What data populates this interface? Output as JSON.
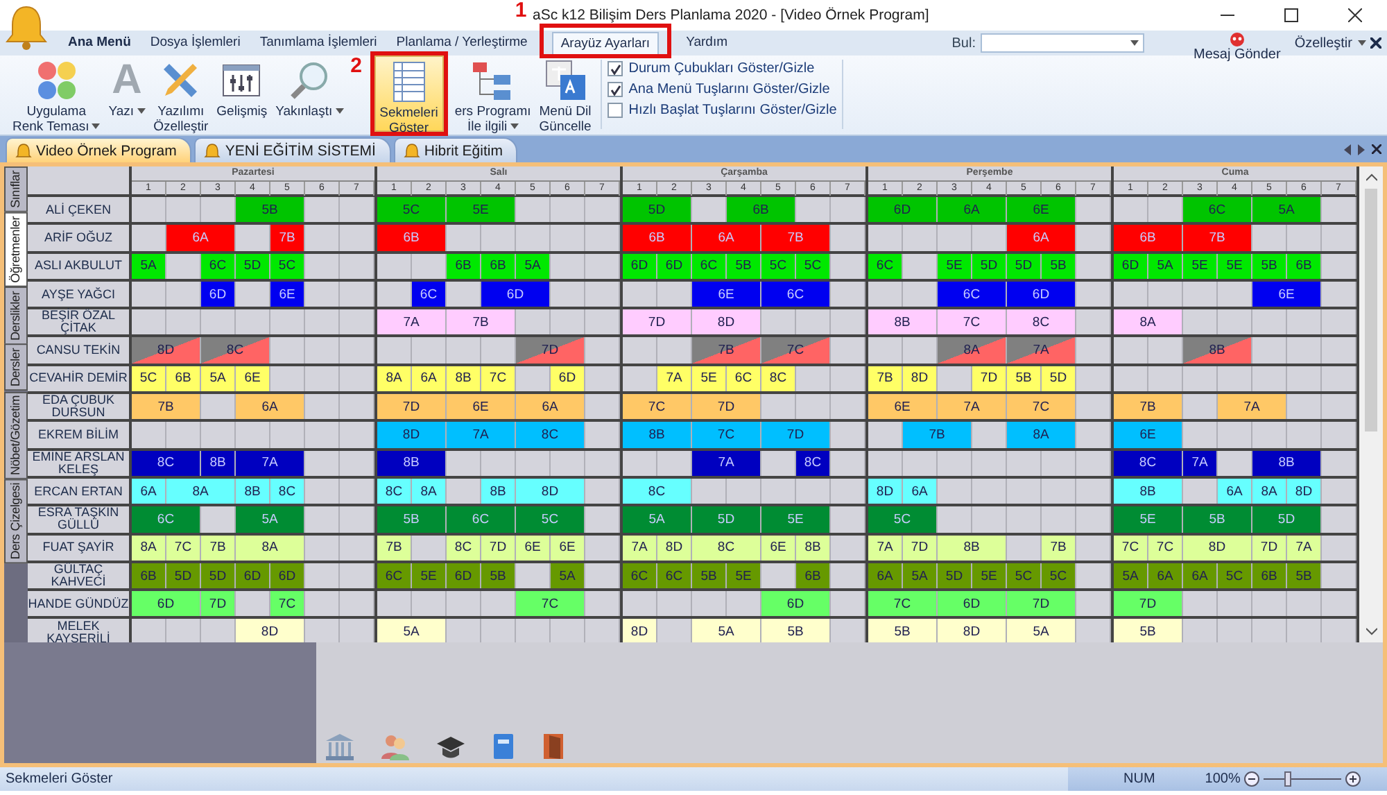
{
  "window": {
    "title": "aSc k12 Bilişim Ders Planlama 2020  - [Video Örnek Program]"
  },
  "menu_tabs": [
    {
      "label": "Ana Menü",
      "selected": false,
      "kind": "main"
    },
    {
      "label": "Dosya İşlemleri",
      "selected": false,
      "kind": "plain"
    },
    {
      "label": "Tanımlama İşlemleri",
      "selected": false,
      "kind": "plain"
    },
    {
      "label": "Planlama / Yerleştirme",
      "selected": false,
      "kind": "plain"
    },
    {
      "label": "Arayüz Ayarları",
      "selected": true,
      "kind": "plain",
      "annotation": "1"
    },
    {
      "label": "Yardım",
      "selected": false,
      "kind": "plain"
    }
  ],
  "find": {
    "label": "Bul:"
  },
  "message_button": {
    "label": "Mesaj Gönder"
  },
  "customize": {
    "label": "Özelleştir"
  },
  "ribbon": {
    "buttons": [
      {
        "label": "Uygulama\nRenk Teması",
        "kind": "palette",
        "dropdown": true,
        "selected": false
      },
      {
        "label": "Yazı",
        "kind": "font",
        "glyph": "A",
        "dropdown": true,
        "selected": false
      },
      {
        "label": "Yazılımı\nÖzelleştir",
        "kind": "tools",
        "dropdown": false,
        "selected": false
      },
      {
        "label": "Gelişmiş",
        "kind": "sliders",
        "dropdown": false,
        "selected": false
      },
      {
        "label": "Yakınlaştı",
        "kind": "magnifier",
        "dropdown": true,
        "selected": false
      },
      {
        "label": "Sekmeleri\nGöster",
        "kind": "sheet",
        "dropdown": false,
        "selected": true,
        "annotation": "2"
      },
      {
        "label": "ers Programı\nİle ilgili",
        "kind": "flow",
        "dropdown": true,
        "selected": false
      },
      {
        "label": "Menü Dil\nGüncelle",
        "kind": "language",
        "dropdown": false,
        "selected": false
      }
    ],
    "checkboxes": [
      {
        "label": "Durum Çubukları Göster/Gizle",
        "checked": true
      },
      {
        "label": "Ana Menü Tuşlarını Göster/Gizle",
        "checked": true
      },
      {
        "label": "Hızlı Başlat Tuşlarını Göster/Gizle",
        "checked": false
      }
    ]
  },
  "document_tabs": [
    {
      "label": "Video Örnek Program",
      "selected": true
    },
    {
      "label": "YENİ EĞİTİM SİSTEMİ",
      "selected": false
    },
    {
      "label": "Hibrit Eğitim",
      "selected": false
    }
  ],
  "side_tabs": [
    {
      "label": "Sınıflar",
      "selected": false
    },
    {
      "label": "Öğretmenler",
      "selected": true
    },
    {
      "label": "Derslikler",
      "selected": false
    },
    {
      "label": "Dersler",
      "selected": false
    },
    {
      "label": "Nöbet/Gözetim",
      "selected": false
    },
    {
      "label": "Ders Çizelgesi",
      "selected": false
    }
  ],
  "days": [
    {
      "name": "Pazartesi",
      "periods": [
        "1",
        "2",
        "3",
        "4",
        "5",
        "6",
        "7"
      ]
    },
    {
      "name": "Salı",
      "periods": [
        "1",
        "2",
        "3",
        "4",
        "5",
        "6",
        "7"
      ]
    },
    {
      "name": "Çarşamba",
      "periods": [
        "1",
        "2",
        "3",
        "4",
        "5",
        "6",
        "7"
      ]
    },
    {
      "name": "Perşembe",
      "periods": [
        "1",
        "2",
        "3",
        "4",
        "5",
        "6",
        "7"
      ]
    },
    {
      "name": "Cuma",
      "periods": [
        "1",
        "2",
        "3",
        "4",
        "5",
        "6",
        "7"
      ]
    }
  ],
  "teachers": [
    {
      "name": "ALİ ÇEKEN",
      "color": "#00c400",
      "kind": "solid",
      "days": [
        [
          {
            "kind": "empty"
          },
          {
            "kind": "empty"
          },
          {
            "kind": "empty"
          },
          {
            "kind": "double",
            "label": "5B"
          },
          {
            "kind": "empty"
          },
          {
            "kind": "empty"
          }
        ],
        [
          {
            "kind": "double",
            "label": "5C"
          },
          {
            "kind": "double",
            "label": "5E"
          },
          {
            "kind": "empty"
          },
          {
            "kind": "empty"
          },
          {
            "kind": "empty"
          }
        ],
        [
          {
            "kind": "double",
            "label": "5D"
          },
          {
            "kind": "empty"
          },
          {
            "kind": "double",
            "label": "6B"
          },
          {
            "kind": "empty"
          },
          {
            "kind": "empty"
          }
        ],
        [
          {
            "kind": "double",
            "label": "6D"
          },
          {
            "kind": "double",
            "label": "6A"
          },
          {
            "kind": "double",
            "label": "6E"
          },
          {
            "kind": "empty"
          }
        ],
        [
          {
            "kind": "empty"
          },
          {
            "kind": "empty"
          },
          {
            "kind": "double",
            "label": "6C"
          },
          {
            "kind": "double",
            "label": "5A"
          },
          {
            "kind": "empty"
          }
        ]
      ]
    },
    {
      "name": "ARİF OĞUZ",
      "color": "#ff0000",
      "kind": "solid",
      "days": [
        [
          {
            "kind": "empty"
          },
          {
            "kind": "double",
            "label": "6A"
          },
          {
            "kind": "empty"
          },
          {
            "kind": "single",
            "label": "7B"
          },
          {
            "kind": "empty"
          },
          {
            "kind": "empty"
          }
        ],
        [
          {
            "kind": "double",
            "label": "6B"
          },
          {
            "kind": "empty"
          },
          {
            "kind": "empty"
          },
          {
            "kind": "empty"
          },
          {
            "kind": "empty"
          },
          {
            "kind": "empty"
          }
        ],
        [
          {
            "kind": "double",
            "label": "6B"
          },
          {
            "kind": "double",
            "label": "6A"
          },
          {
            "kind": "double",
            "label": "7B"
          },
          {
            "kind": "empty"
          }
        ],
        [
          {
            "kind": "empty"
          },
          {
            "kind": "empty"
          },
          {
            "kind": "empty"
          },
          {
            "kind": "empty"
          },
          {
            "kind": "double",
            "label": "6A"
          },
          {
            "kind": "empty"
          }
        ],
        [
          {
            "kind": "double",
            "label": "6B"
          },
          {
            "kind": "double",
            "label": "7B"
          },
          {
            "kind": "empty"
          },
          {
            "kind": "empty"
          },
          {
            "kind": "empty"
          }
        ]
      ]
    },
    {
      "name": "ASLI AKBULUT",
      "color": "#00e800",
      "kind": "solid",
      "days": [
        [
          {
            "kind": "single",
            "label": "5A"
          },
          {
            "kind": "empty"
          },
          {
            "kind": "single",
            "label": "6C"
          },
          {
            "kind": "single",
            "label": "5D"
          },
          {
            "kind": "single",
            "label": "5C"
          },
          {
            "kind": "empty"
          },
          {
            "kind": "empty"
          }
        ],
        [
          {
            "kind": "empty"
          },
          {
            "kind": "empty"
          },
          {
            "kind": "single",
            "label": "6B"
          },
          {
            "kind": "single",
            "label": "6B"
          },
          {
            "kind": "single",
            "label": "5A"
          },
          {
            "kind": "empty"
          },
          {
            "kind": "empty"
          }
        ],
        [
          {
            "kind": "single",
            "label": "6D"
          },
          {
            "kind": "single",
            "label": "6D"
          },
          {
            "kind": "single",
            "label": "6C"
          },
          {
            "kind": "single",
            "label": "5B"
          },
          {
            "kind": "single",
            "label": "5C"
          },
          {
            "kind": "single",
            "label": "5C"
          },
          {
            "kind": "empty"
          }
        ],
        [
          {
            "kind": "single",
            "label": "6C"
          },
          {
            "kind": "empty"
          },
          {
            "kind": "single",
            "label": "5E"
          },
          {
            "kind": "single",
            "label": "5D"
          },
          {
            "kind": "single",
            "label": "5D"
          },
          {
            "kind": "single",
            "label": "5B"
          },
          {
            "kind": "empty"
          }
        ],
        [
          {
            "kind": "single",
            "label": "6D"
          },
          {
            "kind": "single",
            "label": "5A"
          },
          {
            "kind": "single",
            "label": "5E"
          },
          {
            "kind": "single",
            "label": "5E"
          },
          {
            "kind": "single",
            "label": "5B"
          },
          {
            "kind": "single",
            "label": "6B"
          },
          {
            "kind": "empty"
          }
        ]
      ]
    },
    {
      "name": "AYŞE YAĞCI",
      "color": "#0000f0",
      "kind": "solid",
      "days": [
        [
          {
            "kind": "empty"
          },
          {
            "kind": "empty"
          },
          {
            "kind": "single",
            "label": "6D"
          },
          {
            "kind": "empty"
          },
          {
            "kind": "single",
            "label": "6E"
          },
          {
            "kind": "empty"
          },
          {
            "kind": "empty"
          }
        ],
        [
          {
            "kind": "empty"
          },
          {
            "kind": "single",
            "label": "6C"
          },
          {
            "kind": "empty"
          },
          {
            "kind": "double",
            "label": "6D"
          },
          {
            "kind": "empty"
          },
          {
            "kind": "empty"
          }
        ],
        [
          {
            "kind": "empty"
          },
          {
            "kind": "empty"
          },
          {
            "kind": "double",
            "label": "6E"
          },
          {
            "kind": "double",
            "label": "6C"
          },
          {
            "kind": "empty"
          }
        ],
        [
          {
            "kind": "empty"
          },
          {
            "kind": "empty"
          },
          {
            "kind": "double",
            "label": "6C"
          },
          {
            "kind": "double",
            "label": "6D"
          },
          {
            "kind": "empty"
          }
        ],
        [
          {
            "kind": "empty"
          },
          {
            "kind": "empty"
          },
          {
            "kind": "empty"
          },
          {
            "kind": "empty"
          },
          {
            "kind": "double",
            "label": "6E"
          },
          {
            "kind": "empty"
          }
        ]
      ]
    },
    {
      "name": "BEŞİR ÖZAL ÇİTAK",
      "color": "#ffccff",
      "kind": "solid",
      "days": [
        [
          {
            "kind": "empty"
          },
          {
            "kind": "empty"
          },
          {
            "kind": "empty"
          },
          {
            "kind": "empty"
          },
          {
            "kind": "empty"
          },
          {
            "kind": "empty"
          },
          {
            "kind": "empty"
          }
        ],
        [
          {
            "kind": "double",
            "label": "7A"
          },
          {
            "kind": "double",
            "label": "7B"
          },
          {
            "kind": "empty"
          },
          {
            "kind": "empty"
          },
          {
            "kind": "empty"
          }
        ],
        [
          {
            "kind": "double",
            "label": "7D"
          },
          {
            "kind": "double",
            "label": "8D"
          },
          {
            "kind": "empty"
          },
          {
            "kind": "empty"
          },
          {
            "kind": "empty"
          }
        ],
        [
          {
            "kind": "double",
            "label": "8B"
          },
          {
            "kind": "double",
            "label": "7C"
          },
          {
            "kind": "double",
            "label": "8C"
          },
          {
            "kind": "empty"
          }
        ],
        [
          {
            "kind": "double",
            "label": "8A"
          },
          {
            "kind": "empty"
          },
          {
            "kind": "empty"
          },
          {
            "kind": "empty"
          },
          {
            "kind": "empty"
          },
          {
            "kind": "empty"
          }
        ]
      ]
    },
    {
      "name": "CANSU TEKİN",
      "color": "#808080",
      "kind": "split",
      "days": [
        [
          {
            "kind": "double",
            "label": "8D"
          },
          {
            "kind": "double",
            "label": "8C"
          },
          {
            "kind": "empty"
          },
          {
            "kind": "empty"
          },
          {
            "kind": "empty"
          }
        ],
        [
          {
            "kind": "empty"
          },
          {
            "kind": "empty"
          },
          {
            "kind": "empty"
          },
          {
            "kind": "empty"
          },
          {
            "kind": "double",
            "label": "7D"
          },
          {
            "kind": "empty"
          }
        ],
        [
          {
            "kind": "empty"
          },
          {
            "kind": "empty"
          },
          {
            "kind": "double",
            "label": "7B"
          },
          {
            "kind": "double",
            "label": "7C"
          },
          {
            "kind": "empty"
          }
        ],
        [
          {
            "kind": "empty"
          },
          {
            "kind": "empty"
          },
          {
            "kind": "double",
            "label": "8A"
          },
          {
            "kind": "double",
            "label": "7A"
          },
          {
            "kind": "empty"
          }
        ],
        [
          {
            "kind": "empty"
          },
          {
            "kind": "empty"
          },
          {
            "kind": "double",
            "label": "8B"
          },
          {
            "kind": "empty"
          },
          {
            "kind": "empty"
          },
          {
            "kind": "empty"
          }
        ]
      ]
    },
    {
      "name": "CEVAHİR DEMİR",
      "color": "#ffff66",
      "kind": "solid",
      "days": [
        [
          {
            "kind": "single",
            "label": "5C"
          },
          {
            "kind": "single",
            "label": "6B"
          },
          {
            "kind": "single",
            "label": "5A"
          },
          {
            "kind": "single",
            "label": "6E"
          },
          {
            "kind": "empty"
          },
          {
            "kind": "empty"
          },
          {
            "kind": "empty"
          }
        ],
        [
          {
            "kind": "single",
            "label": "8A"
          },
          {
            "kind": "single",
            "label": "6A"
          },
          {
            "kind": "single",
            "label": "8B"
          },
          {
            "kind": "single",
            "label": "7C"
          },
          {
            "kind": "empty"
          },
          {
            "kind": "single",
            "label": "6D"
          },
          {
            "kind": "empty"
          }
        ],
        [
          {
            "kind": "empty"
          },
          {
            "kind": "single",
            "label": "7A"
          },
          {
            "kind": "single",
            "label": "5E"
          },
          {
            "kind": "single",
            "label": "6C"
          },
          {
            "kind": "single",
            "label": "8C"
          },
          {
            "kind": "empty"
          },
          {
            "kind": "empty"
          }
        ],
        [
          {
            "kind": "single",
            "label": "7B"
          },
          {
            "kind": "single",
            "label": "8D"
          },
          {
            "kind": "empty"
          },
          {
            "kind": "single",
            "label": "7D"
          },
          {
            "kind": "single",
            "label": "5B"
          },
          {
            "kind": "single",
            "label": "5D"
          },
          {
            "kind": "empty"
          }
        ],
        [
          {
            "kind": "empty"
          },
          {
            "kind": "empty"
          },
          {
            "kind": "empty"
          },
          {
            "kind": "empty"
          },
          {
            "kind": "empty"
          },
          {
            "kind": "empty"
          },
          {
            "kind": "empty"
          }
        ]
      ]
    },
    {
      "name": "EDA ÇUBUK DURSUN",
      "color": "#ffc866",
      "kind": "solid",
      "days": [
        [
          {
            "kind": "double",
            "label": "7B"
          },
          {
            "kind": "empty"
          },
          {
            "kind": "double",
            "label": "6A"
          },
          {
            "kind": "empty"
          },
          {
            "kind": "empty"
          }
        ],
        [
          {
            "kind": "double",
            "label": "7D"
          },
          {
            "kind": "double",
            "label": "6E"
          },
          {
            "kind": "double",
            "label": "6A"
          },
          {
            "kind": "empty"
          }
        ],
        [
          {
            "kind": "double",
            "label": "7C"
          },
          {
            "kind": "double",
            "label": "7D"
          },
          {
            "kind": "empty"
          },
          {
            "kind": "empty"
          },
          {
            "kind": "empty"
          }
        ],
        [
          {
            "kind": "double",
            "label": "6E"
          },
          {
            "kind": "double",
            "label": "7A"
          },
          {
            "kind": "double",
            "label": "7C"
          },
          {
            "kind": "empty"
          }
        ],
        [
          {
            "kind": "double",
            "label": "7B"
          },
          {
            "kind": "empty"
          },
          {
            "kind": "double",
            "label": "7A"
          },
          {
            "kind": "empty"
          },
          {
            "kind": "empty"
          }
        ]
      ]
    },
    {
      "name": "EKREM BİLİM",
      "color": "#00bfff",
      "kind": "solid",
      "days": [
        [
          {
            "kind": "empty"
          },
          {
            "kind": "empty"
          },
          {
            "kind": "empty"
          },
          {
            "kind": "empty"
          },
          {
            "kind": "empty"
          },
          {
            "kind": "empty"
          },
          {
            "kind": "empty"
          }
        ],
        [
          {
            "kind": "double",
            "label": "8D"
          },
          {
            "kind": "double",
            "label": "7A"
          },
          {
            "kind": "double",
            "label": "8C"
          },
          {
            "kind": "empty"
          }
        ],
        [
          {
            "kind": "double",
            "label": "8B"
          },
          {
            "kind": "double",
            "label": "7C"
          },
          {
            "kind": "double",
            "label": "7D"
          },
          {
            "kind": "empty"
          }
        ],
        [
          {
            "kind": "empty"
          },
          {
            "kind": "double",
            "label": "7B"
          },
          {
            "kind": "empty"
          },
          {
            "kind": "double",
            "label": "8A"
          },
          {
            "kind": "empty"
          }
        ],
        [
          {
            "kind": "double",
            "label": "6E"
          },
          {
            "kind": "empty"
          },
          {
            "kind": "empty"
          },
          {
            "kind": "empty"
          },
          {
            "kind": "empty"
          },
          {
            "kind": "empty"
          }
        ]
      ]
    },
    {
      "name": "EMİNE ARSLAN KELEŞ",
      "color": "#0000c0",
      "kind": "solid",
      "days": [
        [
          {
            "kind": "double",
            "label": "8C"
          },
          {
            "kind": "single",
            "label": "8B"
          },
          {
            "kind": "double",
            "label": "7A"
          },
          {
            "kind": "empty"
          },
          {
            "kind": "empty"
          }
        ],
        [
          {
            "kind": "double",
            "label": "8B"
          },
          {
            "kind": "empty"
          },
          {
            "kind": "empty"
          },
          {
            "kind": "empty"
          },
          {
            "kind": "empty"
          },
          {
            "kind": "empty"
          }
        ],
        [
          {
            "kind": "empty"
          },
          {
            "kind": "empty"
          },
          {
            "kind": "double",
            "label": "7A"
          },
          {
            "kind": "empty"
          },
          {
            "kind": "single",
            "label": "8C"
          },
          {
            "kind": "empty"
          }
        ],
        [
          {
            "kind": "empty"
          },
          {
            "kind": "empty"
          },
          {
            "kind": "empty"
          },
          {
            "kind": "empty"
          },
          {
            "kind": "empty"
          },
          {
            "kind": "empty"
          },
          {
            "kind": "empty"
          }
        ],
        [
          {
            "kind": "double",
            "label": "8C"
          },
          {
            "kind": "single",
            "label": "7A"
          },
          {
            "kind": "empty"
          },
          {
            "kind": "double",
            "label": "8B"
          },
          {
            "kind": "empty"
          }
        ]
      ]
    },
    {
      "name": "ERCAN ERTAN",
      "color": "#66ffff",
      "kind": "solid",
      "days": [
        [
          {
            "kind": "single",
            "label": "6A"
          },
          {
            "kind": "double",
            "label": "8A"
          },
          {
            "kind": "single",
            "label": "8B"
          },
          {
            "kind": "single",
            "label": "8C"
          },
          {
            "kind": "empty"
          },
          {
            "kind": "empty"
          }
        ],
        [
          {
            "kind": "single",
            "label": "8C"
          },
          {
            "kind": "single",
            "label": "8A"
          },
          {
            "kind": "empty"
          },
          {
            "kind": "single",
            "label": "8B"
          },
          {
            "kind": "double",
            "label": "8D"
          },
          {
            "kind": "empty"
          }
        ],
        [
          {
            "kind": "double",
            "label": "8C"
          },
          {
            "kind": "empty"
          },
          {
            "kind": "empty"
          },
          {
            "kind": "empty"
          },
          {
            "kind": "empty"
          },
          {
            "kind": "empty"
          }
        ],
        [
          {
            "kind": "single",
            "label": "8D"
          },
          {
            "kind": "single",
            "label": "6A"
          },
          {
            "kind": "empty"
          },
          {
            "kind": "empty"
          },
          {
            "kind": "empty"
          },
          {
            "kind": "empty"
          },
          {
            "kind": "empty"
          }
        ],
        [
          {
            "kind": "double",
            "label": "8B"
          },
          {
            "kind": "empty"
          },
          {
            "kind": "single",
            "label": "6A"
          },
          {
            "kind": "single",
            "label": "8A"
          },
          {
            "kind": "single",
            "label": "8D"
          },
          {
            "kind": "empty"
          }
        ]
      ]
    },
    {
      "name": "ESRA TAŞKIN GÜLLÜ",
      "color": "#008c33",
      "kind": "solid",
      "days": [
        [
          {
            "kind": "double",
            "label": "6C"
          },
          {
            "kind": "empty"
          },
          {
            "kind": "double",
            "label": "5A"
          },
          {
            "kind": "empty"
          },
          {
            "kind": "empty"
          }
        ],
        [
          {
            "kind": "double",
            "label": "5B"
          },
          {
            "kind": "double",
            "label": "6C"
          },
          {
            "kind": "double",
            "label": "5C"
          },
          {
            "kind": "empty"
          }
        ],
        [
          {
            "kind": "double",
            "label": "5A"
          },
          {
            "kind": "double",
            "label": "5D"
          },
          {
            "kind": "double",
            "label": "5E"
          },
          {
            "kind": "empty"
          }
        ],
        [
          {
            "kind": "double",
            "label": "5C"
          },
          {
            "kind": "empty"
          },
          {
            "kind": "empty"
          },
          {
            "kind": "empty"
          },
          {
            "kind": "empty"
          },
          {
            "kind": "empty"
          }
        ],
        [
          {
            "kind": "double",
            "label": "5E"
          },
          {
            "kind": "double",
            "label": "5B"
          },
          {
            "kind": "double",
            "label": "5D"
          },
          {
            "kind": "empty"
          }
        ]
      ]
    },
    {
      "name": "FUAT ŞAYİR",
      "color": "#ddff99",
      "kind": "solid",
      "days": [
        [
          {
            "kind": "single",
            "label": "8A"
          },
          {
            "kind": "single",
            "label": "7C"
          },
          {
            "kind": "single",
            "label": "7B"
          },
          {
            "kind": "double",
            "label": "8A"
          },
          {
            "kind": "empty"
          },
          {
            "kind": "empty"
          }
        ],
        [
          {
            "kind": "single",
            "label": "7B"
          },
          {
            "kind": "empty"
          },
          {
            "kind": "single",
            "label": "8C"
          },
          {
            "kind": "single",
            "label": "7D"
          },
          {
            "kind": "single",
            "label": "6E"
          },
          {
            "kind": "single",
            "label": "6E"
          },
          {
            "kind": "empty"
          }
        ],
        [
          {
            "kind": "single",
            "label": "7A"
          },
          {
            "kind": "single",
            "label": "8D"
          },
          {
            "kind": "double",
            "label": "8C"
          },
          {
            "kind": "single",
            "label": "6E"
          },
          {
            "kind": "single",
            "label": "8B"
          },
          {
            "kind": "empty"
          }
        ],
        [
          {
            "kind": "single",
            "label": "7A"
          },
          {
            "kind": "single",
            "label": "7D"
          },
          {
            "kind": "double",
            "label": "8B"
          },
          {
            "kind": "empty"
          },
          {
            "kind": "single",
            "label": "7B"
          },
          {
            "kind": "empty"
          }
        ],
        [
          {
            "kind": "single",
            "label": "7C"
          },
          {
            "kind": "single",
            "label": "7C"
          },
          {
            "kind": "double",
            "label": "8D"
          },
          {
            "kind": "single",
            "label": "7D"
          },
          {
            "kind": "single",
            "label": "7A"
          },
          {
            "kind": "empty"
          }
        ]
      ]
    },
    {
      "name": "GÜLTAÇ KAHVECİ",
      "color": "#669900",
      "kind": "solid",
      "days": [
        [
          {
            "kind": "single",
            "label": "6B"
          },
          {
            "kind": "single",
            "label": "5D"
          },
          {
            "kind": "single",
            "label": "5D"
          },
          {
            "kind": "single",
            "label": "6D"
          },
          {
            "kind": "single",
            "label": "6D"
          },
          {
            "kind": "empty"
          },
          {
            "kind": "empty"
          }
        ],
        [
          {
            "kind": "single",
            "label": "6C"
          },
          {
            "kind": "single",
            "label": "5E"
          },
          {
            "kind": "single",
            "label": "6D"
          },
          {
            "kind": "single",
            "label": "5B"
          },
          {
            "kind": "empty"
          },
          {
            "kind": "single",
            "label": "5A"
          },
          {
            "kind": "empty"
          }
        ],
        [
          {
            "kind": "single",
            "label": "6C"
          },
          {
            "kind": "single",
            "label": "6C"
          },
          {
            "kind": "single",
            "label": "5B"
          },
          {
            "kind": "single",
            "label": "5E"
          },
          {
            "kind": "empty"
          },
          {
            "kind": "single",
            "label": "6B"
          },
          {
            "kind": "empty"
          }
        ],
        [
          {
            "kind": "single",
            "label": "6A"
          },
          {
            "kind": "single",
            "label": "5A"
          },
          {
            "kind": "single",
            "label": "5D"
          },
          {
            "kind": "single",
            "label": "5E"
          },
          {
            "kind": "single",
            "label": "5C"
          },
          {
            "kind": "single",
            "label": "5C"
          },
          {
            "kind": "empty"
          }
        ],
        [
          {
            "kind": "single",
            "label": "5A"
          },
          {
            "kind": "single",
            "label": "6A"
          },
          {
            "kind": "single",
            "label": "6A"
          },
          {
            "kind": "single",
            "label": "5C"
          },
          {
            "kind": "single",
            "label": "6B"
          },
          {
            "kind": "single",
            "label": "5B"
          },
          {
            "kind": "empty"
          }
        ]
      ]
    },
    {
      "name": "HANDE GÜNDÜZ",
      "color": "#66ff66",
      "kind": "solid",
      "days": [
        [
          {
            "kind": "double",
            "label": "6D"
          },
          {
            "kind": "single",
            "label": "7D"
          },
          {
            "kind": "empty"
          },
          {
            "kind": "single",
            "label": "7C"
          },
          {
            "kind": "empty"
          },
          {
            "kind": "empty"
          }
        ],
        [
          {
            "kind": "empty"
          },
          {
            "kind": "empty"
          },
          {
            "kind": "empty"
          },
          {
            "kind": "empty"
          },
          {
            "kind": "double",
            "label": "7C"
          },
          {
            "kind": "empty"
          }
        ],
        [
          {
            "kind": "empty"
          },
          {
            "kind": "empty"
          },
          {
            "kind": "empty"
          },
          {
            "kind": "empty"
          },
          {
            "kind": "double",
            "label": "6D"
          },
          {
            "kind": "empty"
          }
        ],
        [
          {
            "kind": "double",
            "label": "7C"
          },
          {
            "kind": "double",
            "label": "6D"
          },
          {
            "kind": "double",
            "label": "7D"
          },
          {
            "kind": "empty"
          }
        ],
        [
          {
            "kind": "double",
            "label": "7D"
          },
          {
            "kind": "empty"
          },
          {
            "kind": "empty"
          },
          {
            "kind": "empty"
          },
          {
            "kind": "empty"
          },
          {
            "kind": "empty"
          }
        ]
      ]
    },
    {
      "name": "MELEK KAYSERİLİ",
      "color": "#ffffcc",
      "kind": "solid",
      "days": [
        [
          {
            "kind": "empty"
          },
          {
            "kind": "empty"
          },
          {
            "kind": "empty"
          },
          {
            "kind": "double",
            "label": "8D"
          },
          {
            "kind": "empty"
          },
          {
            "kind": "empty"
          }
        ],
        [
          {
            "kind": "double",
            "label": "5A"
          },
          {
            "kind": "empty"
          },
          {
            "kind": "empty"
          },
          {
            "kind": "empty"
          },
          {
            "kind": "empty"
          },
          {
            "kind": "empty"
          }
        ],
        [
          {
            "kind": "single",
            "label": "8D"
          },
          {
            "kind": "empty"
          },
          {
            "kind": "double",
            "label": "5A"
          },
          {
            "kind": "double",
            "label": "5B"
          },
          {
            "kind": "empty"
          }
        ],
        [
          {
            "kind": "double",
            "label": "5B"
          },
          {
            "kind": "double",
            "label": "8D"
          },
          {
            "kind": "double",
            "label": "5A"
          },
          {
            "kind": "empty"
          }
        ],
        [
          {
            "kind": "double",
            "label": "5B"
          },
          {
            "kind": "empty"
          },
          {
            "kind": "empty"
          },
          {
            "kind": "empty"
          },
          {
            "kind": "empty"
          },
          {
            "kind": "empty"
          }
        ]
      ]
    }
  ],
  "status_bar": {
    "text": "Sekmeleri Göster",
    "num": "NUM",
    "zoom": "100%",
    "zoom_slider": {
      "level": 0.3
    }
  }
}
